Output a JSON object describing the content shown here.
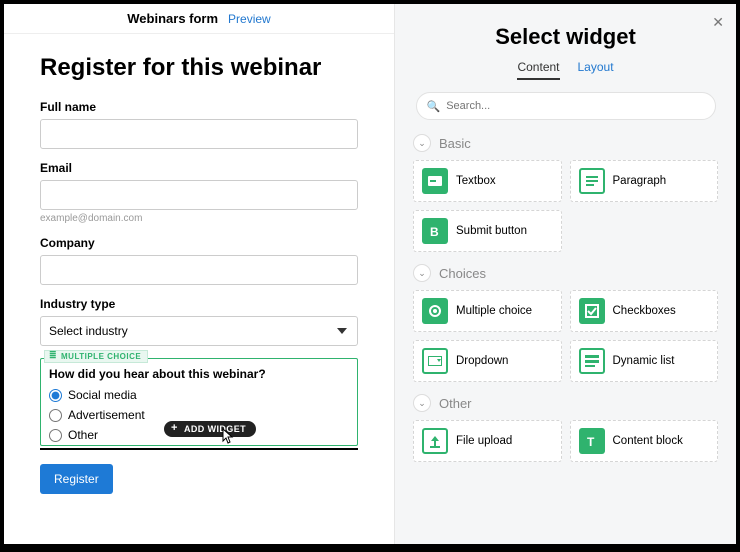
{
  "topbar": {
    "title": "Webinars form",
    "preview": "Preview"
  },
  "form": {
    "title": "Register for this webinar",
    "fullname_label": "Full name",
    "email_label": "Email",
    "email_hint": "example@domain.com",
    "company_label": "Company",
    "industry_label": "Industry type",
    "industry_placeholder": "Select industry"
  },
  "mc": {
    "tag": "MULTIPLE CHOICE",
    "question": "How did you hear about this webinar?",
    "options": [
      "Social media",
      "Advertisement",
      "Other"
    ]
  },
  "add_widget_label": "ADD WIDGET",
  "register_label": "Register",
  "panel": {
    "title": "Select widget",
    "tab_content": "Content",
    "tab_layout": "Layout",
    "search_placeholder": "Search...",
    "sec_basic": "Basic",
    "sec_choices": "Choices",
    "sec_other": "Other",
    "w_textbox": "Textbox",
    "w_paragraph": "Paragraph",
    "w_submit": "Submit button",
    "w_mc": "Multiple choice",
    "w_checkboxes": "Checkboxes",
    "w_dropdown": "Dropdown",
    "w_dynlist": "Dynamic list",
    "w_upload": "File upload",
    "w_content": "Content block"
  }
}
